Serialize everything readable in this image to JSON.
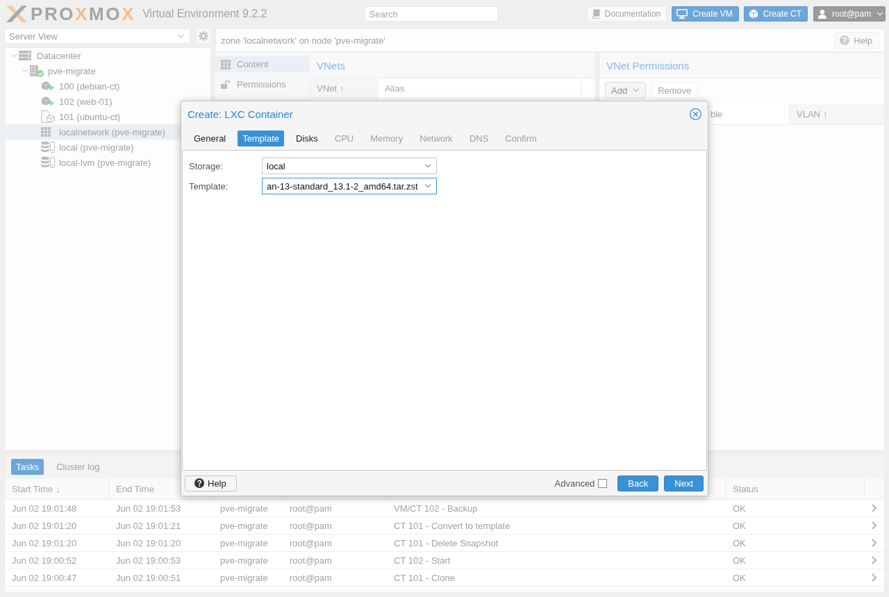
{
  "topbar": {
    "logo": {
      "parts": [
        {
          "text": "PRO",
          "accent": false
        },
        {
          "text": "X",
          "accent": true
        },
        {
          "text": "MO",
          "accent": false
        },
        {
          "text": "X",
          "accent": true
        }
      ]
    },
    "product": "Virtual Environment 9.2.2",
    "search": {
      "placeholder": "Search"
    },
    "buttons": [
      {
        "label": "Documentation",
        "kind": "docs"
      },
      {
        "label": "Create VM",
        "kind": "vm"
      },
      {
        "label": "Create CT",
        "kind": "ct"
      }
    ],
    "user": {
      "label": "root@pam"
    }
  },
  "sidebar": {
    "view": {
      "value": "Server View"
    },
    "tree": [
      {
        "label": "Datacenter",
        "kind": "datacenter",
        "selected": false,
        "expanded": true,
        "children": [
          {
            "label": "pve-migrate",
            "kind": "node",
            "online": true,
            "selected": false,
            "expanded": true,
            "children": [
              {
                "label": "100 (debian-ct)",
                "kind": "container",
                "running": true,
                "selected": false
              },
              {
                "label": "102 (web-01)",
                "kind": "container",
                "running": true,
                "selected": false
              },
              {
                "label": "101 (ubuntu-ct)",
                "kind": "template",
                "selected": false
              },
              {
                "label": "localnetwork (pve-migrate)",
                "kind": "zone",
                "selected": true
              },
              {
                "label": "local (pve-migrate)",
                "kind": "storage",
                "selected": false
              },
              {
                "label": "local-lvm (pve-migrate)",
                "kind": "storage",
                "selected": false
              }
            ]
          }
        ]
      }
    ]
  },
  "content": {
    "title": "zone 'localnetwork' on node 'pve-migrate'",
    "help": "Help",
    "nav": [
      {
        "label": "Content",
        "kind": "grid",
        "selected": true
      },
      {
        "label": "Permissions",
        "kind": "lock",
        "selected": false
      }
    ],
    "vnets": {
      "title": "VNets",
      "columns": [
        {
          "label": "VNet",
          "sort_mark": "↑"
        },
        {
          "label": "Alias"
        },
        {}
      ]
    },
    "permissions": {
      "title": "VNet Permissions",
      "toolbar": [
        {
          "label": "Add",
          "kind": "menu",
          "disabled": false
        },
        {
          "label": "Remove",
          "kind": "plain",
          "disabled": true
        }
      ],
      "columns": [
        {},
        {
          "label": "ble"
        },
        {
          "label": "VLAN",
          "sort_mark": "↑"
        }
      ]
    }
  },
  "tasks": {
    "tabs": [
      {
        "label": "Tasks",
        "selected": true
      },
      {
        "label": "Cluster log",
        "selected": false
      }
    ],
    "columns": [
      {
        "label": "Start Time",
        "sort_mark": "↓"
      },
      {
        "label": "End Time"
      },
      {},
      {},
      {},
      {
        "label": "Status"
      },
      {}
    ],
    "rows": [
      {
        "cells": [
          "Jun 02 19:01:48",
          "Jun 02 19:01:53",
          "pve-migrate",
          "root@pam",
          "VM/CT 102 - Backup",
          "OK"
        ]
      },
      {
        "cells": [
          "Jun 02 19:01:20",
          "Jun 02 19:01:21",
          "pve-migrate",
          "root@pam",
          "CT 101 - Convert to template",
          "OK"
        ]
      },
      {
        "cells": [
          "Jun 02 19:01:20",
          "Jun 02 19:01:20",
          "pve-migrate",
          "root@pam",
          "CT 101 - Delete Snapshot",
          "OK"
        ]
      },
      {
        "cells": [
          "Jun 02 19:00:52",
          "Jun 02 19:00:53",
          "pve-migrate",
          "root@pam",
          "CT 102 - Start",
          "OK"
        ]
      },
      {
        "cells": [
          "Jun 02 19:00:47",
          "Jun 02 19:00:51",
          "pve-migrate",
          "root@pam",
          "CT 101 - Clone",
          "OK"
        ]
      }
    ]
  },
  "dialog": {
    "title": "Create: LXC Container",
    "tabs": [
      {
        "label": "General",
        "selected": false,
        "disabled": false
      },
      {
        "label": "Template",
        "selected": true,
        "disabled": false
      },
      {
        "label": "Disks",
        "selected": false,
        "disabled": false
      },
      {
        "label": "CPU",
        "selected": false,
        "disabled": true
      },
      {
        "label": "Memory",
        "selected": false,
        "disabled": true
      },
      {
        "label": "Network",
        "selected": false,
        "disabled": true
      },
      {
        "label": "DNS",
        "selected": false,
        "disabled": true
      },
      {
        "label": "Confirm",
        "selected": false,
        "disabled": true
      }
    ],
    "fields": [
      {
        "label": "Storage:",
        "value": "local",
        "focused": false
      },
      {
        "label": "Template:",
        "value": "an-13-standard_13.1-2_amd64.tar.zst",
        "focused": true
      }
    ],
    "help": "Help",
    "advanced": {
      "label": "Advanced",
      "checked": false
    },
    "buttons": [
      {
        "label": "Back"
      },
      {
        "label": "Next"
      }
    ]
  }
}
